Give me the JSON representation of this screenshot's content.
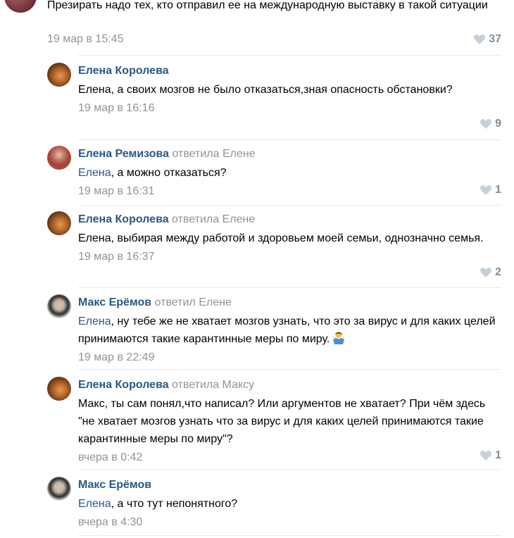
{
  "top_comment": {
    "text": "Презирать надо тех, кто отправил ее на международную выставку в такой ситуации",
    "time": "19 мар в 15:45",
    "likes": "37"
  },
  "replies": [
    {
      "author": "Елена Королева",
      "answered": "",
      "addressee": "",
      "text": "Елена, а своих мозгов не было отказаться,зная опасность обстановки?",
      "time": "19 мар в 16:16",
      "likes": "9"
    },
    {
      "author": "Елена Ремизова",
      "answered": "ответила Елене",
      "addressee": "Елена",
      "text": ", а можно отказаться?",
      "time": "19 мар в 16:31",
      "likes": "1"
    },
    {
      "author": "Елена Королева",
      "answered": "ответила Елене",
      "addressee": "",
      "text": "Елена, выбирая между работой и здоровьем моей семьи, однозначно семья.",
      "time": "19 мар в 16:37",
      "likes": "2"
    },
    {
      "author": "Макс Ерёмов",
      "answered": "ответил Елене",
      "addressee": "Елена",
      "text": ", ну тебе же не хватает мозгов узнать, что это за вирус и для каких целей принимаются такие карантинные меры по миру.",
      "time": "19 мар в 22:49",
      "likes": ""
    },
    {
      "author": "Елена Королева",
      "answered": "ответила Максу",
      "addressee": "",
      "text": "Макс, ты сам понял,что написал? Или аргументов не хватает? При чём здесь \"не хватает мозгов узнать что за вирус и для каких целей принимаются такие карантинные меры по миру\"?",
      "time": "вчера в 0:42",
      "likes": "1"
    },
    {
      "author": "Макс Ерёмов",
      "answered": "",
      "addressee": "Елена",
      "text": ", а что тут непонятного?",
      "time": "вчера в 4:30",
      "likes": ""
    }
  ],
  "icons": {
    "like": "heart-icon",
    "emoji": "person-shrugging-emoji"
  },
  "colors": {
    "author": "#2a5885",
    "meta": "#939393",
    "like": "#828a99",
    "separator": "#e7e8ec"
  }
}
